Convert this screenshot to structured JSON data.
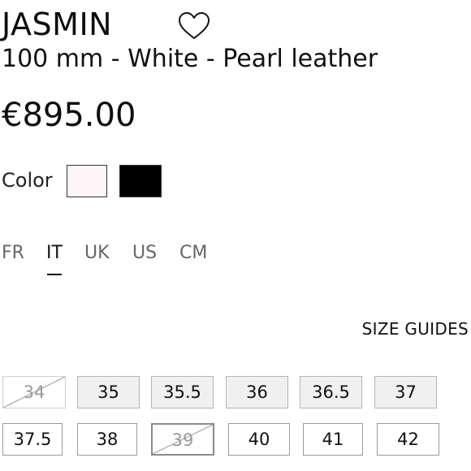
{
  "product": {
    "name": "JASMIN",
    "variant": "100 mm - White - Pearl leather",
    "price": "€895.00",
    "favorite_icon": "heart-outline-icon"
  },
  "color": {
    "label": "Color",
    "swatches": [
      {
        "name": "White",
        "hex": "#fdf7f9"
      },
      {
        "name": "Black",
        "hex": "#000000"
      }
    ]
  },
  "size_systems": {
    "tabs": [
      "FR",
      "IT",
      "UK",
      "US",
      "CM"
    ],
    "active": "IT"
  },
  "size_guides_label": "SIZE GUIDES",
  "sizes": {
    "row1": [
      {
        "label": "34",
        "available": false
      },
      {
        "label": "35",
        "available": true
      },
      {
        "label": "35.5",
        "available": true
      },
      {
        "label": "36",
        "available": true
      },
      {
        "label": "36.5",
        "available": true
      },
      {
        "label": "37",
        "available": true
      }
    ],
    "row2": [
      {
        "label": "37.5",
        "available": true
      },
      {
        "label": "38",
        "available": true
      },
      {
        "label": "39",
        "available": false,
        "selected": true
      },
      {
        "label": "40",
        "available": true
      },
      {
        "label": "41",
        "available": true
      },
      {
        "label": "42",
        "available": true
      }
    ]
  }
}
